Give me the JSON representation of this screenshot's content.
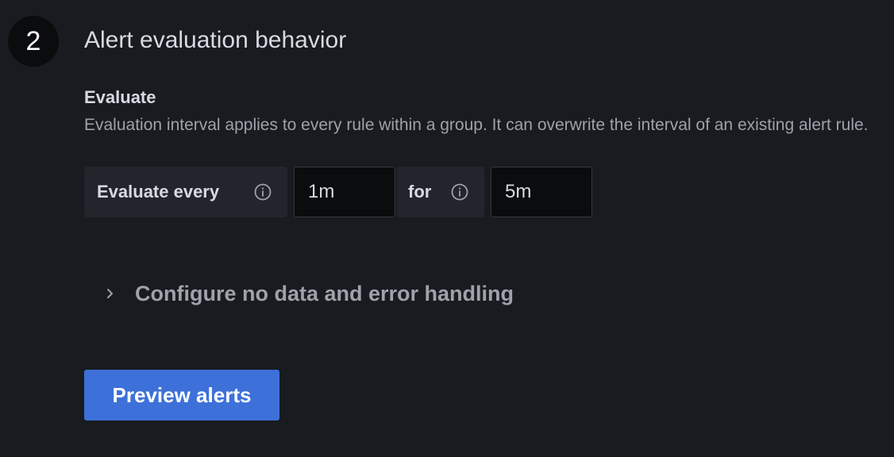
{
  "section": {
    "step_number": "2",
    "title": "Alert evaluation behavior"
  },
  "evaluate": {
    "label": "Evaluate",
    "description": "Evaluation interval applies to every rule within a group. It can overwrite the interval of an existing alert rule.",
    "every_label": "Evaluate every",
    "every_value": "1m",
    "for_label": "for",
    "for_value": "5m"
  },
  "no_data": {
    "label": "Configure no data and error handling"
  },
  "preview": {
    "button_label": "Preview alerts"
  },
  "icons": {
    "info": "info-icon",
    "chevron": "chevron-right-icon"
  },
  "colors": {
    "background": "#181b1f",
    "primary_button": "#3d71d9",
    "input_background": "#0b0c0e"
  }
}
